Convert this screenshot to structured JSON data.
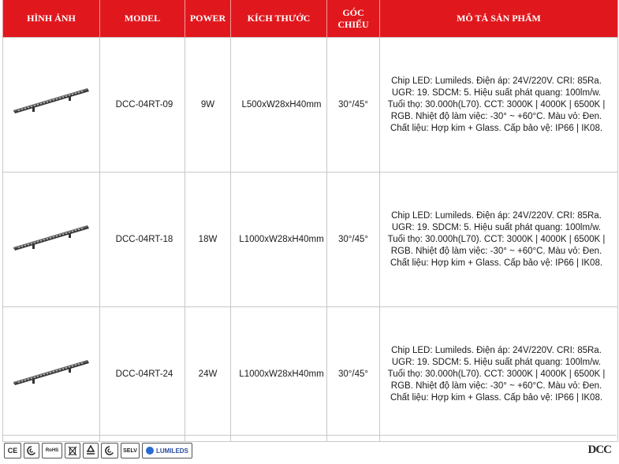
{
  "headers": {
    "image": "HÌNH ẢNH",
    "model": "MODEL",
    "power": "POWER",
    "size": "KÍCH THƯỚC",
    "angle": "GÓC CHIẾU",
    "description": "MÔ TẢ SẢN PHẨM"
  },
  "rows": [
    {
      "model": "DCC-04RT-09",
      "power": "9W",
      "size": "L500xW28xH40mm",
      "angle": "30°/45°",
      "description": "Chip LED: Lumileds. Điện áp: 24V/220V. CRI: 85Ra. UGR: 19. SDCM: 5. Hiệu suất phát quang: 100lm/w. Tuổi thọ: 30.000h(L70). CCT: 3000K | 4000K | 6500K | RGB. Nhiệt độ làm việc: -30° ~ +60°C. Màu vỏ: Đen. Chất liệu: Hợp kim + Glass. Cấp bảo vệ: IP66 | IK08."
    },
    {
      "model": "DCC-04RT-18",
      "power": "18W",
      "size": "L1000xW28xH40mm",
      "angle": "30°/45°",
      "description": "Chip LED: Lumileds. Điện áp: 24V/220V. CRI: 85Ra. UGR: 19. SDCM: 5. Hiệu suất phát quang: 100lm/w. Tuổi thọ: 30.000h(L70). CCT: 3000K | 4000K | 6500K | RGB. Nhiệt độ làm việc: -30° ~ +60°C. Màu vỏ: Đen. Chất liệu: Hợp kim + Glass. Cấp bảo vệ: IP66 | IK08."
    },
    {
      "model": "DCC-04RT-24",
      "power": "24W",
      "size": "L1000xW28xH40mm",
      "angle": "30°/45°",
      "description": "Chip LED: Lumileds. Điện áp: 24V/220V. CRI: 85Ra. UGR: 19. SDCM: 5. Hiệu suất phát quang: 100lm/w. Tuổi thọ: 30.000h(L70). CCT: 3000K | 4000K | 6500K | RGB. Nhiệt độ làm việc: -30° ~ +60°C. Màu vỏ: Đen. Chất liệu: Hợp kim + Glass. Cấp bảo vệ: IP66 | IK08."
    }
  ],
  "certifications": {
    "ce": "CE",
    "rohs": "RoHS",
    "selv": "SELV",
    "lumileds": "LUMILEDS"
  },
  "brand": "DCC",
  "colors": {
    "header_bg": "#e0181e",
    "header_text": "#ffffff",
    "border": "#c8c8c8"
  }
}
